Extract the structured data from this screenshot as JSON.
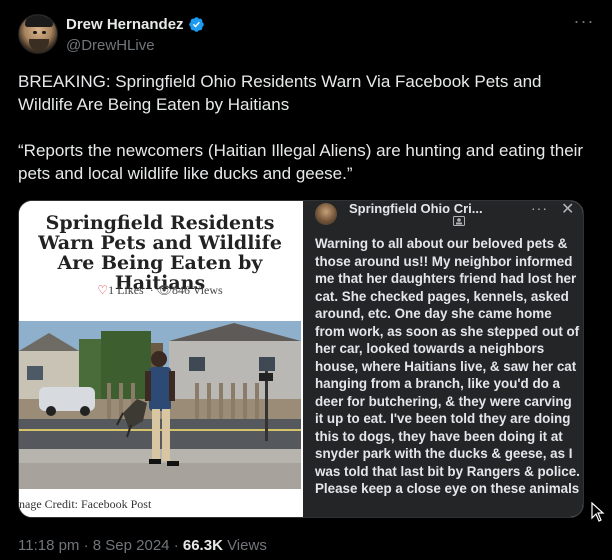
{
  "author": {
    "name": "Drew Hernandez",
    "handle": "@DrewHLive",
    "verified_icon": "verified-badge-icon",
    "verified_color": "#1d9bf0"
  },
  "more_icon": "more-options-icon",
  "tweet": {
    "paragraph_1": "BREAKING: Springfield Ohio Residents Warn Via Facebook Pets and Wildlife Are Being Eaten by Haitians",
    "paragraph_2": "“Reports the newcomers (Haitian Illegal Aliens) are hunting and eating their pets and local wildlife like ducks and geese.”"
  },
  "media": {
    "article": {
      "title": "Springfield Residents Warn Pets and Wildlife Are Being Eaten by Haitians",
      "likes": "1 Likes",
      "views": "846 Views",
      "image_credit": "nage Credit: Facebook Post"
    },
    "facebook_post": {
      "group_name": "Springfield Ohio Cri...",
      "body": "Warning to all about our beloved pets & those around us!! My neighbor informed me that her daughters friend had lost her cat. She checked pages, kennels, asked around, etc. One day she came home from work, as soon as she stepped out of her car, looked towards a neighbors house, where Haitians live, & saw her cat hanging from a branch, like you'd do a deer for butchering, & they were carving it up to eat. I've been told they are doing this to dogs, they have been doing it at snyder park with the ducks & geese, as I was told that last bit by Rangers & police. Please keep a close eye on these animals"
    }
  },
  "footer": {
    "time": "11:18 pm",
    "separator": "·",
    "date": "8 Sep 2024",
    "views_count": "66.3K",
    "views_label": "Views"
  },
  "colors": {
    "background": "#000000",
    "text_primary": "#e7e9ea",
    "text_secondary": "#71767b",
    "fb_panel": "#242526"
  }
}
